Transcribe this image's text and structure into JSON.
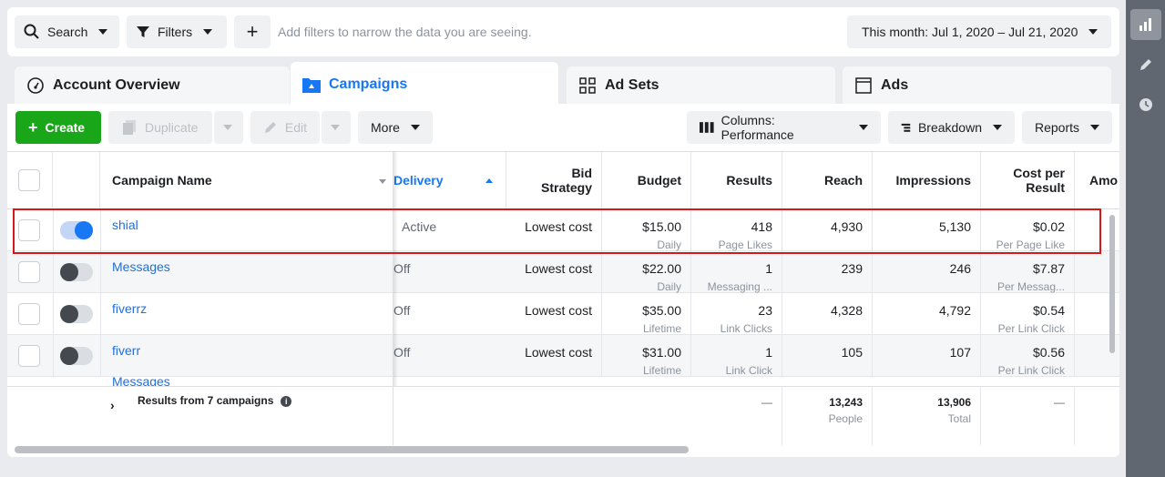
{
  "topbar": {
    "search_label": "Search",
    "filters_label": "Filters",
    "add_label": "+",
    "filter_hint": "Add filters to narrow the data you are seeing.",
    "date_range": "This month: Jul 1, 2020 – Jul 21, 2020"
  },
  "tabs": {
    "account_overview": "Account Overview",
    "campaigns": "Campaigns",
    "ad_sets": "Ad Sets",
    "ads": "Ads"
  },
  "toolbar": {
    "create": "Create",
    "duplicate": "Duplicate",
    "edit": "Edit",
    "more": "More",
    "columns": "Columns: Performance",
    "breakdown": "Breakdown",
    "reports": "Reports"
  },
  "columns": {
    "campaign_name": "Campaign Name",
    "delivery": "Delivery",
    "bid_strategy": "Bid Strategy",
    "budget": "Budget",
    "results": "Results",
    "reach": "Reach",
    "impressions": "Impressions",
    "cost_per_result": "Cost per Result",
    "amount": "Amo"
  },
  "rows": [
    {
      "name": "shial",
      "on": true,
      "delivery": "Active",
      "bid": "Lowest cost",
      "budget": "$15.00",
      "budget_sub": "Daily",
      "results": "418",
      "results_sub": "Page Likes",
      "reach": "4,930",
      "impressions": "5,130",
      "cost": "$0.02",
      "cost_sub": "Per Page Like"
    },
    {
      "name": "Messages",
      "on": false,
      "delivery": "Off",
      "bid": "Lowest cost",
      "budget": "$22.00",
      "budget_sub": "Daily",
      "results": "1",
      "results_sub": "Messaging ...",
      "reach": "239",
      "impressions": "246",
      "cost": "$7.87",
      "cost_sub": "Per Messag..."
    },
    {
      "name": "fiverrz",
      "on": false,
      "delivery": "Off",
      "bid": "Lowest cost",
      "budget": "$35.00",
      "budget_sub": "Lifetime",
      "results": "23",
      "results_sub": "Link Clicks",
      "reach": "4,328",
      "impressions": "4,792",
      "cost": "$0.54",
      "cost_sub": "Per Link Click"
    },
    {
      "name": "fiverr",
      "on": false,
      "delivery": "Off",
      "bid": "Lowest cost",
      "budget": "$31.00",
      "budget_sub": "Lifetime",
      "results": "1",
      "results_sub": "Link Click",
      "reach": "105",
      "impressions": "107",
      "cost": "$0.56",
      "cost_sub": "Per Link Click"
    }
  ],
  "footer": {
    "label": "Results from 7 campaigns",
    "results": "—",
    "reach": "13,243",
    "reach_sub": "People",
    "impressions": "13,906",
    "impressions_sub": "Total",
    "cost": "—"
  }
}
